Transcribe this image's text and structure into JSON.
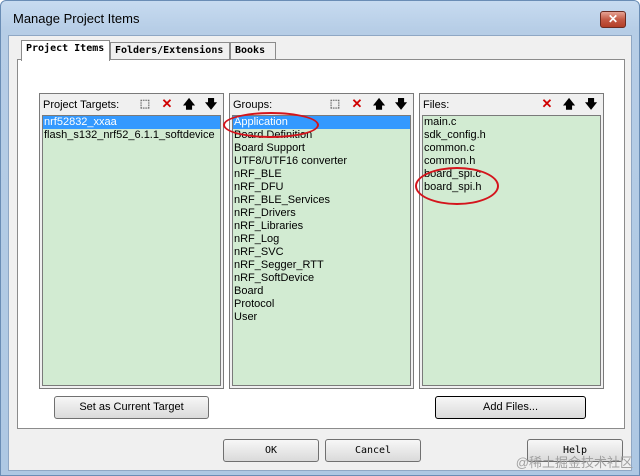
{
  "window": {
    "title": "Manage Project Items",
    "close_glyph": "✕"
  },
  "tabs": [
    {
      "label": "Project Items"
    },
    {
      "label": "Folders/Extensions"
    },
    {
      "label": "Books"
    }
  ],
  "targets": {
    "title": "Project Targets:",
    "items": [
      "nrf52832_xxaa",
      "flash_s132_nrf52_6.1.1_softdevice"
    ]
  },
  "groups": {
    "title": "Groups:",
    "items": [
      "Application",
      "Board Definition",
      "Board Support",
      "UTF8/UTF16 converter",
      "nRF_BLE",
      "nRF_DFU",
      "nRF_BLE_Services",
      "nRF_Drivers",
      "nRF_Libraries",
      "nRF_Log",
      "nRF_SVC",
      "nRF_Segger_RTT",
      "nRF_SoftDevice",
      "Board",
      "Protocol",
      "User"
    ]
  },
  "files": {
    "title": "Files:",
    "items": [
      "main.c",
      "sdk_config.h",
      "common.c",
      "common.h",
      "board_spi.c",
      "board_spi.h"
    ]
  },
  "toolbar_icons": {
    "new": "new-icon",
    "delete": "delete-icon",
    "up": "move-up-icon",
    "down": "move-down-icon",
    "glyphs": {
      "new": "⬚",
      "delete": "✕",
      "up": "🡅",
      "down": "🡇"
    }
  },
  "buttons": {
    "set_current": "Set as Current Target",
    "add_files": "Add Files...",
    "ok": "OK",
    "cancel": "Cancel",
    "help": "Help"
  },
  "watermark": "@稀土掘金技术社区",
  "colors": {
    "list_bg": "#d2ebd2",
    "selection": "#3399ff",
    "annotation": "#d4141c"
  }
}
